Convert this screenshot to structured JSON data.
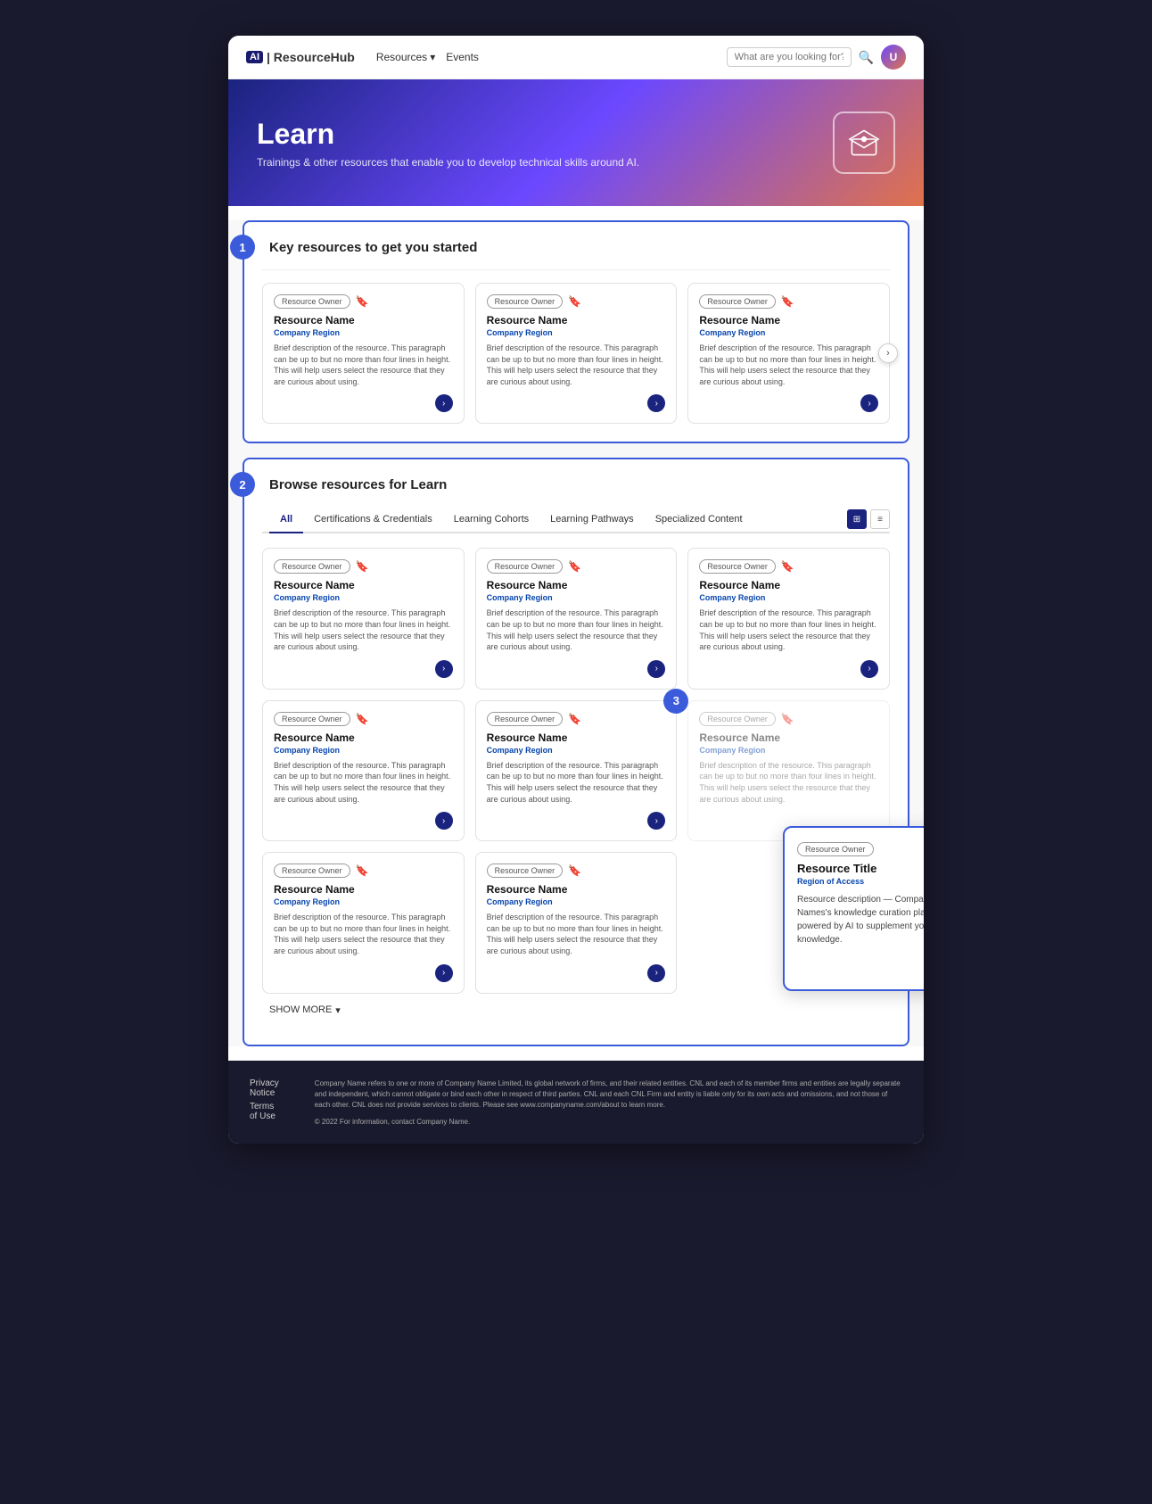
{
  "navbar": {
    "logo": {
      "ai_text": "AI",
      "brand_text": "| ResourceHub"
    },
    "nav_links": [
      {
        "label": "Resources",
        "has_dropdown": true
      },
      {
        "label": "Events",
        "has_dropdown": false
      }
    ],
    "search_placeholder": "What are you looking for?",
    "user_initial": "U"
  },
  "hero": {
    "title": "Learn",
    "subtitle": "Trainings & other resources that enable you to develop technical skills around AI."
  },
  "section1": {
    "number": "1",
    "title": "Key resources to get you started",
    "cards": [
      {
        "badge": "Resource Owner",
        "title": "Resource Name",
        "region": "Company Region",
        "desc": "Brief description of the resource. This paragraph can be up to but no more than four lines in height. This will help users select the resource that they are curious about using."
      },
      {
        "badge": "Resource Owner",
        "title": "Resource Name",
        "region": "Company Region",
        "desc": "Brief description of the resource. This paragraph can be up to but no more than four lines in height. This will help users select the resource that they are curious about using."
      },
      {
        "badge": "Resource Owner",
        "title": "Resource Name",
        "region": "Company Region",
        "desc": "Brief description of the resource. This paragraph can be up to but no more than four lines in height. This will help users select the resource that they are curious about using."
      }
    ]
  },
  "section2": {
    "number": "2",
    "title": "Browse resources for Learn",
    "tabs": [
      {
        "label": "All",
        "active": true
      },
      {
        "label": "Certifications & Credentials",
        "active": false
      },
      {
        "label": "Learning Cohorts",
        "active": false
      },
      {
        "label": "Learning Pathways",
        "active": false
      },
      {
        "label": "Specialized Content",
        "active": false
      }
    ],
    "grid_cards": [
      {
        "badge": "Resource Owner",
        "title": "Resource Name",
        "region": "Company Region",
        "desc": "Brief description of the resource. This paragraph can be up to but no more than four lines in height. This will help users select the resource that they are curious about using."
      },
      {
        "badge": "Resource Owner",
        "title": "Resource Name",
        "region": "Company Region",
        "desc": "Brief description of the resource. This paragraph can be up to but no more than four lines in height. This will help users select the resource that they are curious about using."
      },
      {
        "badge": "Resource Owner",
        "title": "Resource Name",
        "region": "Company Region",
        "desc": "Brief description of the resource. This paragraph can be up to but no more than four lines in height. This will help users select the resource that they are curious about using."
      },
      {
        "badge": "Resource Owner",
        "title": "Resource Name",
        "region": "Company Region",
        "desc": "Brief description of the resource. This paragraph can be up to but no more than four lines in height. This will help users select the resource that they are curious about using."
      },
      {
        "badge": "Resource Owner",
        "title": "Resource Name",
        "region": "Company Region",
        "desc": "Brief description of the resource. This paragraph can be up to but no more than four lines in height. This will help users select the resource that they are curious about using."
      },
      {
        "badge": "Resource Owner",
        "title": "Resource Name",
        "region": "Company Region",
        "desc": "Brief description of the resource. This paragraph can be up to but no more than four lines in height. This will help users select the resource that they are curious about using."
      },
      {
        "badge": "Resource Owner",
        "title": "Resource Name",
        "region": "Company Region",
        "desc": "Brief description of the resource. This paragraph can be up to but no more than four lines in height. This will help users select the resource that they are curious about using."
      },
      {
        "badge": "Resource Owner",
        "title": "Resource Name",
        "region": "Company Region",
        "desc": "Brief description of the resource. This paragraph can be up to but no more than four lines in height. This will help users select the resource that they are curious about using."
      }
    ],
    "show_more_label": "SHOW MORE"
  },
  "tooltip": {
    "badge": "Resource Owner",
    "title": "Resource Title",
    "region": "Region of Access",
    "desc": "Resource description — Company Names's knowledge curation platform powered by AI to supplement your ML knowledge."
  },
  "step3_label": "3",
  "footer": {
    "links": [
      {
        "label": "Privacy Notice"
      },
      {
        "label": "Terms of Use"
      }
    ],
    "legal_text": "Company Name refers to one or more of Company Name Limited, its global network of firms, and their related entities. CNL and each of its member firms and entities are legally separate and independent, which cannot obligate or bind each other in respect of third parties. CNL and each CNL Firm and entity is liable only for its own acts and omissions, and not those of each other. CNL does not provide services to clients. Please see www.companyname.com/about to learn more.",
    "copyright": "© 2022 For information, contact Company Name."
  }
}
